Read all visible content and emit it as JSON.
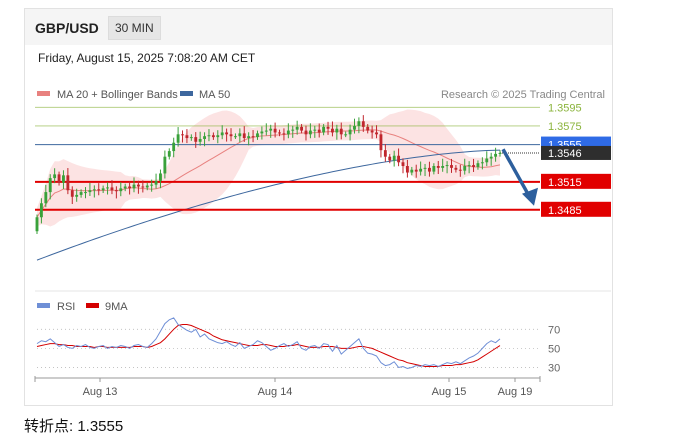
{
  "header": {
    "pair": "GBP/USD",
    "timeframe": "30 MIN"
  },
  "datetime": "Friday, August 15, 2025 7:08:20 AM CET",
  "footer": {
    "pivot_label": "转折点: 1.3555"
  },
  "colors": {
    "up": "#39a13a",
    "down": "#c0262d",
    "ma20": "#e8817f",
    "band_fill": "#fbdcdc",
    "ma50": "#3d679e",
    "support": "#e10000",
    "pivot": "#2f6be6",
    "resistance": "#8bb43d",
    "rsi": "#6f8fd6",
    "rsi_ma": "#d40000",
    "arrow": "#2d5f9d"
  },
  "chart_data": [
    {
      "type": "candlestick",
      "legend": [
        {
          "name": "MA 20 + Bollinger Bands",
          "color": "#e8817f"
        },
        {
          "name": "MA 50",
          "color": "#3d679e"
        }
      ],
      "source": "Research © 2025 Trading Central",
      "ylim": [
        1.34,
        1.362
      ],
      "levels": [
        {
          "value": 1.3595,
          "label": "1.3595",
          "kind": "resistance"
        },
        {
          "value": 1.3575,
          "label": "1.3575",
          "kind": "resistance"
        },
        {
          "value": 1.3555,
          "label": "1.3555",
          "kind": "pivot"
        },
        {
          "value": 1.3546,
          "label": "1.3546",
          "kind": "last"
        },
        {
          "value": 1.3515,
          "label": "1.3515",
          "kind": "support"
        },
        {
          "value": 1.3485,
          "label": "1.3485",
          "kind": "support"
        }
      ],
      "close": [
        1.3477,
        1.3492,
        1.3504,
        1.3519,
        1.3523,
        1.3514,
        1.3522,
        1.3506,
        1.3499,
        1.3501,
        1.3504,
        1.3504,
        1.3506,
        1.3507,
        1.3506,
        1.3508,
        1.3509,
        1.3506,
        1.3505,
        1.3508,
        1.351,
        1.3508,
        1.3512,
        1.351,
        1.3509,
        1.3511,
        1.3512,
        1.3516,
        1.3524,
        1.3542,
        1.3548,
        1.3557,
        1.3566,
        1.3565,
        1.3562,
        1.3563,
        1.3558,
        1.3561,
        1.3564,
        1.3565,
        1.3563,
        1.3565,
        1.3568,
        1.3566,
        1.3564,
        1.3564,
        1.3567,
        1.3562,
        1.3564,
        1.3563,
        1.3567,
        1.3569,
        1.357,
        1.3572,
        1.3568,
        1.3567,
        1.3566,
        1.357,
        1.3571,
        1.3574,
        1.357,
        1.3566,
        1.357,
        1.3571,
        1.3568,
        1.3574,
        1.3572,
        1.3568,
        1.3572,
        1.3566,
        1.3566,
        1.3571,
        1.3575,
        1.358,
        1.3574,
        1.357,
        1.3568,
        1.3566,
        1.3549,
        1.3542,
        1.3538,
        1.3543,
        1.3536,
        1.3532,
        1.3525,
        1.3528,
        1.3526,
        1.3529,
        1.353,
        1.3526,
        1.3532,
        1.353,
        1.3532,
        1.3533,
        1.353,
        1.3528,
        1.3527,
        1.3532,
        1.3533,
        1.3531,
        1.3535,
        1.3536,
        1.354,
        1.3542,
        1.3545,
        1.3546
      ],
      "ma50_start": 1.3431,
      "ma50_end": 1.3549,
      "forecast_from": 1.355,
      "forecast_to": 1.3485,
      "x_ticks": [
        "Aug 13",
        "Aug 14",
        "Aug 15",
        "Aug 19"
      ]
    },
    {
      "type": "line",
      "legend": [
        {
          "name": "RSI",
          "color": "#6f8fd6"
        },
        {
          "name": "9MA",
          "color": "#d40000"
        }
      ],
      "ylim": [
        20,
        85
      ],
      "y_ticks": [
        70,
        50,
        30
      ],
      "series": [
        {
          "name": "RSI",
          "values": [
            55,
            58,
            57,
            60,
            56,
            52,
            54,
            51,
            50,
            53,
            52,
            54,
            51,
            50,
            52,
            53,
            50,
            52,
            51,
            53,
            52,
            50,
            53,
            54,
            52,
            51,
            55,
            60,
            68,
            76,
            80,
            82,
            75,
            72,
            69,
            67,
            70,
            62,
            65,
            60,
            58,
            56,
            55,
            57,
            54,
            52,
            56,
            50,
            52,
            54,
            58,
            56,
            52,
            48,
            50,
            53,
            55,
            52,
            54,
            57,
            50,
            48,
            52,
            53,
            50,
            55,
            54,
            47,
            53,
            44,
            48,
            52,
            56,
            60,
            50,
            45,
            44,
            42,
            35,
            32,
            33,
            36,
            30,
            31,
            29,
            30,
            32,
            31,
            33,
            32,
            33,
            31,
            33,
            35,
            34,
            36,
            34,
            37,
            40,
            42,
            45,
            50,
            55,
            58,
            56,
            60
          ]
        },
        {
          "name": "9MA",
          "values": [
            52,
            53,
            54,
            55,
            55,
            54,
            54,
            53,
            53,
            52,
            52,
            52,
            52,
            51,
            52,
            52,
            51,
            51,
            51,
            51,
            51,
            51,
            52,
            52,
            52,
            51,
            52,
            54,
            56,
            60,
            65,
            70,
            74,
            75,
            75,
            74,
            72,
            70,
            68,
            66,
            63,
            61,
            59,
            58,
            57,
            56,
            55,
            54,
            53,
            53,
            53,
            54,
            54,
            53,
            52,
            52,
            52,
            53,
            53,
            54,
            53,
            52,
            51,
            51,
            51,
            52,
            52,
            52,
            51,
            50,
            50,
            50,
            51,
            52,
            52,
            51,
            50,
            48,
            46,
            44,
            42,
            40,
            38,
            37,
            35,
            34,
            33,
            32,
            31,
            31,
            31,
            31,
            32,
            32,
            32,
            33,
            33,
            34,
            35,
            36,
            38,
            41,
            44,
            47,
            50,
            53
          ]
        }
      ],
      "x_ticks": [
        "Aug 13",
        "Aug 14",
        "Aug 15",
        "Aug 19"
      ]
    }
  ]
}
